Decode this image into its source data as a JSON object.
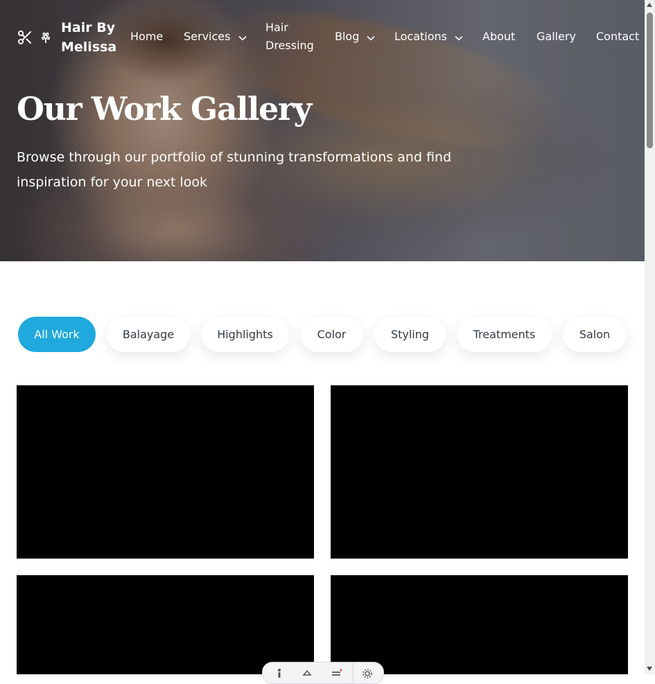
{
  "brand": {
    "name": "Hair By Melissa",
    "icons": [
      "scissors-icon",
      "flower-icon"
    ]
  },
  "nav": {
    "items": [
      {
        "label": "Home",
        "dropdown": false
      },
      {
        "label": "Services",
        "dropdown": true
      },
      {
        "label": "Hair Dressing",
        "dropdown": false
      },
      {
        "label": "Blog",
        "dropdown": true
      },
      {
        "label": "Locations",
        "dropdown": true
      },
      {
        "label": "About",
        "dropdown": false
      },
      {
        "label": "Gallery",
        "dropdown": false
      },
      {
        "label": "Contact",
        "dropdown": false
      }
    ]
  },
  "hero": {
    "title": "Our Work Gallery",
    "subtitle": "Browse through our portfolio of stunning transformations and find inspiration for your next look"
  },
  "filters": {
    "active": "All Work",
    "items": [
      "All Work",
      "Balayage",
      "Highlights",
      "Color",
      "Styling",
      "Treatments",
      "Salon"
    ]
  },
  "colors": {
    "accent": "#1fa9dd",
    "tile": "#000000",
    "text": "#333a45"
  },
  "toolbar": {
    "icons": [
      "accessibility-icon",
      "paint-icon",
      "menu-icon",
      "settings-icon"
    ]
  }
}
